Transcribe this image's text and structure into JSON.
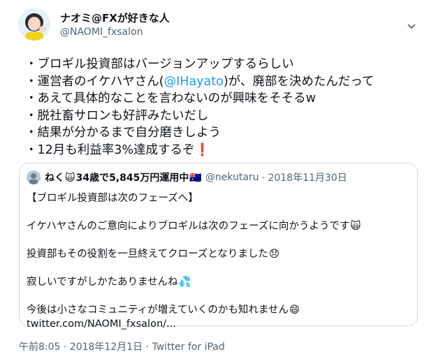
{
  "author": {
    "display_name": "ナオミ@FXが好きな人",
    "handle": "@NAOMI_fxsalon"
  },
  "menu_icon": "chevron-down-icon",
  "tweet": {
    "lines": [
      {
        "text": "・ブロギル投資部はバージョンアップするらしい"
      },
      {
        "before": "・運営者のイケハヤさん(",
        "mention": "@IHayato",
        "after": ")が、廃部を決めたんだって"
      },
      {
        "text": "・あえて具体的なことを言わないのが興味をそそるw"
      },
      {
        "text": "・脱社畜サロンも好評みたいだし"
      },
      {
        "text": "・結果が分かるまで自分磨きしよう"
      },
      {
        "text": "・12月も利益率3%達成するぞ",
        "emoji": "❗"
      }
    ]
  },
  "quoted": {
    "name_prefix": "ねく",
    "name_middle": "34歳で5,845万円運用中",
    "flag": "🇦🇺",
    "handle": "@nekutaru",
    "date": "· 2018年11月30日",
    "title": "【ブロギル投資部は次のフェーズへ】",
    "p1": "イケハヤさんのご意向によりブロギルは次のフェーズに向かうようです",
    "p1_emoji": "🙀",
    "p2": "投資部もその役割を一旦終えてクローズとなりました",
    "p2_emoji": "😞",
    "p3": "寂しいですがしかたありませんね",
    "p3_emoji": "💦",
    "p4": "今後は小さなコミュニティが増えていくのかも知れません",
    "p4_emoji": "😄",
    "link": "twitter.com/NAOMI_fxsalon/..."
  },
  "footer": {
    "time": "午前8:05 · 2018年12月1日 · ",
    "source": "Twitter for iPad"
  },
  "colors": {
    "link": "#1d9bf0",
    "secondary": "#536471",
    "border": "#cfd9de"
  }
}
